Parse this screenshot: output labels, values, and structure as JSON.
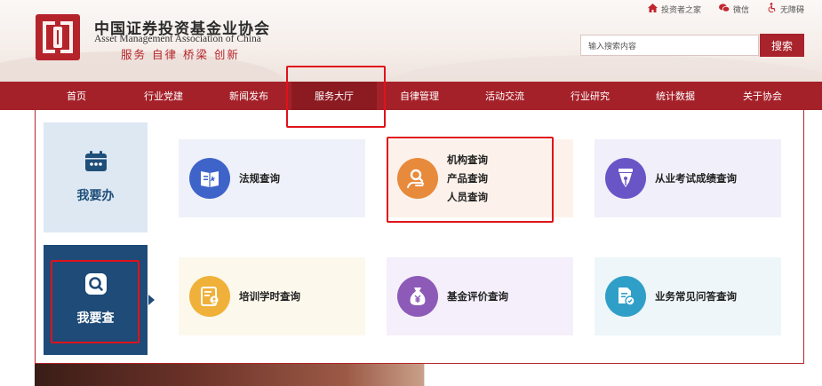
{
  "header": {
    "org_name_cn": "中国证券投资基金业协会",
    "org_name_en": "Asset Management Association of China",
    "slogan": "服务 自律 桥梁 创新",
    "top_links": [
      {
        "label": "投资者之家",
        "icon": "home-icon"
      },
      {
        "label": "微信",
        "icon": "wechat-icon"
      },
      {
        "label": "无障碍",
        "icon": "accessibility-icon"
      }
    ],
    "search": {
      "placeholder": "输入搜索内容",
      "button_label": "搜索"
    }
  },
  "nav": {
    "items": [
      "首页",
      "行业党建",
      "新闻发布",
      "服务大厅",
      "自律管理",
      "活动交流",
      "行业研究",
      "统计数据",
      "关于协会"
    ],
    "active_index": 3
  },
  "service_hall": {
    "todo_tile": {
      "label": "我要办",
      "icon": "calendar-icon"
    },
    "query_tile": {
      "label": "我要查",
      "icon": "search-icon"
    },
    "cards": [
      {
        "title": "法规查询",
        "icon": "book-icon",
        "color": "#3f64c9"
      },
      {
        "lines": [
          "机构查询",
          "产品查询",
          "人员查询"
        ],
        "icon": "person-search-icon",
        "color": "#e88a3b"
      },
      {
        "title": "从业考试成绩查询",
        "icon": "pen-nib-icon",
        "color": "#6a55c7"
      },
      {
        "title": "培训学时查询",
        "icon": "certificate-icon",
        "color": "#f0b13a"
      },
      {
        "title": "基金评价查询",
        "icon": "money-bag-icon",
        "color": "#8d5ab8"
      },
      {
        "title": "业务常见问答查询",
        "icon": "document-chat-icon",
        "color": "#2f9fc7"
      }
    ]
  },
  "colors": {
    "brand_red": "#a52129",
    "nav_active": "#8c1a21",
    "query_tile_blue": "#1e4b78",
    "highlight_red": "#e0121b"
  }
}
